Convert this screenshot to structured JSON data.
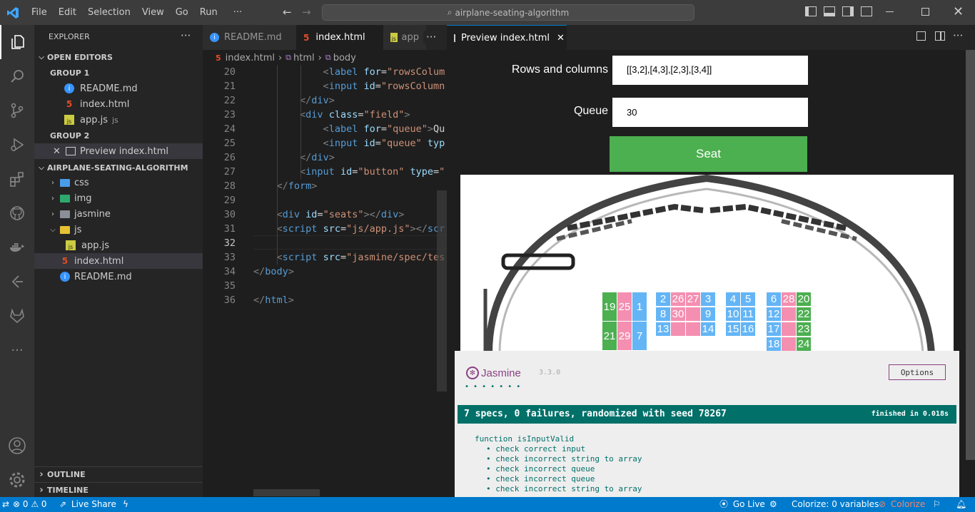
{
  "titlebar": {
    "menus": [
      "File",
      "Edit",
      "Selection",
      "View",
      "Go",
      "Run",
      "···"
    ],
    "search": "airplane-seating-algorithm"
  },
  "sidebar": {
    "title": "EXPLORER",
    "open_editors": "OPEN EDITORS",
    "group1": "GROUP 1",
    "group2": "GROUP 2",
    "g1_files": [
      {
        "name": "README.md",
        "suffix": ""
      },
      {
        "name": "index.html",
        "suffix": ""
      },
      {
        "name": "app.js",
        "suffix": "js"
      }
    ],
    "g2_files": [
      {
        "name": "Preview index.html"
      }
    ],
    "project": "AIRPLANE-SEATING-ALGORITHM",
    "tree": [
      "css",
      "img",
      "jasmine",
      "js",
      "app.js",
      "index.html",
      "README.md"
    ],
    "outline": "OUTLINE",
    "timeline": "TIMELINE"
  },
  "editor": {
    "tabs": [
      "README.md",
      "index.html",
      "app"
    ],
    "breadcrumb": [
      "index.html",
      "html",
      "body"
    ],
    "lines": [
      {
        "n": "20",
        "indent": "            ",
        "parts": [
          [
            "<",
            "t-punc"
          ],
          [
            "label",
            "t-tag"
          ],
          [
            " for",
            "t-attr"
          ],
          [
            "=",
            "t-txt"
          ],
          [
            "\"rowsColum",
            "t-str"
          ]
        ]
      },
      {
        "n": "21",
        "indent": "            ",
        "parts": [
          [
            "<",
            "t-punc"
          ],
          [
            "input",
            "t-tag"
          ],
          [
            " id",
            "t-attr"
          ],
          [
            "=",
            "t-txt"
          ],
          [
            "\"rowsColumn",
            "t-str"
          ]
        ]
      },
      {
        "n": "22",
        "indent": "        ",
        "parts": [
          [
            "</",
            "t-punc"
          ],
          [
            "div",
            "t-tag"
          ],
          [
            ">",
            "t-punc"
          ]
        ]
      },
      {
        "n": "23",
        "indent": "        ",
        "parts": [
          [
            "<",
            "t-punc"
          ],
          [
            "div",
            "t-tag"
          ],
          [
            " class",
            "t-attr"
          ],
          [
            "=",
            "t-txt"
          ],
          [
            "\"field\"",
            "t-str"
          ],
          [
            ">",
            "t-punc"
          ]
        ]
      },
      {
        "n": "24",
        "indent": "            ",
        "parts": [
          [
            "<",
            "t-punc"
          ],
          [
            "label",
            "t-tag"
          ],
          [
            " for",
            "t-attr"
          ],
          [
            "=",
            "t-txt"
          ],
          [
            "\"queue\"",
            "t-str"
          ],
          [
            ">",
            "t-punc"
          ],
          [
            "Qu",
            "t-txt"
          ]
        ]
      },
      {
        "n": "25",
        "indent": "            ",
        "parts": [
          [
            "<",
            "t-punc"
          ],
          [
            "input",
            "t-tag"
          ],
          [
            " id",
            "t-attr"
          ],
          [
            "=",
            "t-txt"
          ],
          [
            "\"queue\"",
            "t-str"
          ],
          [
            " typ",
            "t-attr"
          ]
        ]
      },
      {
        "n": "26",
        "indent": "        ",
        "parts": [
          [
            "</",
            "t-punc"
          ],
          [
            "div",
            "t-tag"
          ],
          [
            ">",
            "t-punc"
          ]
        ]
      },
      {
        "n": "27",
        "indent": "        ",
        "parts": [
          [
            "<",
            "t-punc"
          ],
          [
            "input",
            "t-tag"
          ],
          [
            " id",
            "t-attr"
          ],
          [
            "=",
            "t-txt"
          ],
          [
            "\"button\"",
            "t-str"
          ],
          [
            " type",
            "t-attr"
          ],
          [
            "=",
            "t-txt"
          ],
          [
            "\"",
            "t-str"
          ]
        ]
      },
      {
        "n": "28",
        "indent": "    ",
        "parts": [
          [
            "</",
            "t-punc"
          ],
          [
            "form",
            "t-tag"
          ],
          [
            ">",
            "t-punc"
          ]
        ]
      },
      {
        "n": "29",
        "indent": "",
        "parts": []
      },
      {
        "n": "30",
        "indent": "    ",
        "parts": [
          [
            "<",
            "t-punc"
          ],
          [
            "div",
            "t-tag"
          ],
          [
            " id",
            "t-attr"
          ],
          [
            "=",
            "t-txt"
          ],
          [
            "\"seats\"",
            "t-str"
          ],
          [
            "></",
            "t-punc"
          ],
          [
            "div",
            "t-tag"
          ],
          [
            ">",
            "t-punc"
          ]
        ]
      },
      {
        "n": "31",
        "indent": "    ",
        "parts": [
          [
            "<",
            "t-punc"
          ],
          [
            "script",
            "t-tag"
          ],
          [
            " src",
            "t-attr"
          ],
          [
            "=",
            "t-txt"
          ],
          [
            "\"js/app.js\"",
            "t-str"
          ],
          [
            "></",
            "t-punc"
          ],
          [
            "scr",
            "t-tag"
          ]
        ]
      },
      {
        "n": "32",
        "indent": "",
        "parts": []
      },
      {
        "n": "33",
        "indent": "    ",
        "parts": [
          [
            "<",
            "t-punc"
          ],
          [
            "script",
            "t-tag"
          ],
          [
            " src",
            "t-attr"
          ],
          [
            "=",
            "t-txt"
          ],
          [
            "\"jasmine/spec/tes",
            "t-str"
          ]
        ]
      },
      {
        "n": "34",
        "indent": "",
        "parts": [
          [
            "</",
            "t-punc"
          ],
          [
            "body",
            "t-tag"
          ],
          [
            ">",
            "t-punc"
          ]
        ]
      },
      {
        "n": "35",
        "indent": "",
        "parts": []
      },
      {
        "n": "36",
        "indent": "",
        "parts": [
          [
            "</",
            "t-punc"
          ],
          [
            "html",
            "t-tag"
          ],
          [
            ">",
            "t-punc"
          ]
        ]
      }
    ]
  },
  "preview": {
    "tab": "Preview index.html",
    "rows_label": "Rows and columns",
    "rows_value": "[[3,2],[4,3],[2,3],[3,4]]",
    "queue_label": "Queue",
    "queue_value": "30",
    "seat_button": "Seat",
    "seats": [
      [
        "19",
        "25",
        "1",
        "21",
        "29",
        "7"
      ],
      [
        "2",
        "26",
        "27",
        "3",
        "8",
        "30",
        "",
        "9",
        "13",
        "",
        "",
        "14"
      ],
      [
        "4",
        "5",
        "10",
        "11",
        "15",
        "16"
      ],
      [
        "6",
        "28",
        "20",
        "12",
        "",
        "22",
        "17",
        "",
        "23",
        "18",
        "",
        "24"
      ]
    ],
    "jasmine": {
      "brand": "Jasmine",
      "version": "3.3.0",
      "options": "Options",
      "dots": "• • • • • • •",
      "summary": "7 specs, 0 failures, randomized with seed 78267",
      "finished": "finished in 0.018s",
      "suite": "function isInputValid",
      "specs": [
        "check correct input",
        "check incorrect string to array",
        "check incorrect queue",
        "check incorrect queue",
        "check incorrect string to array"
      ]
    }
  },
  "statusbar": {
    "problems": "⊗ 0 ⚠ 0",
    "liveshare": "Live Share",
    "golive": "Go Live",
    "colorize_vars": "Colorize: 0 variables",
    "colorize": "Colorize"
  }
}
